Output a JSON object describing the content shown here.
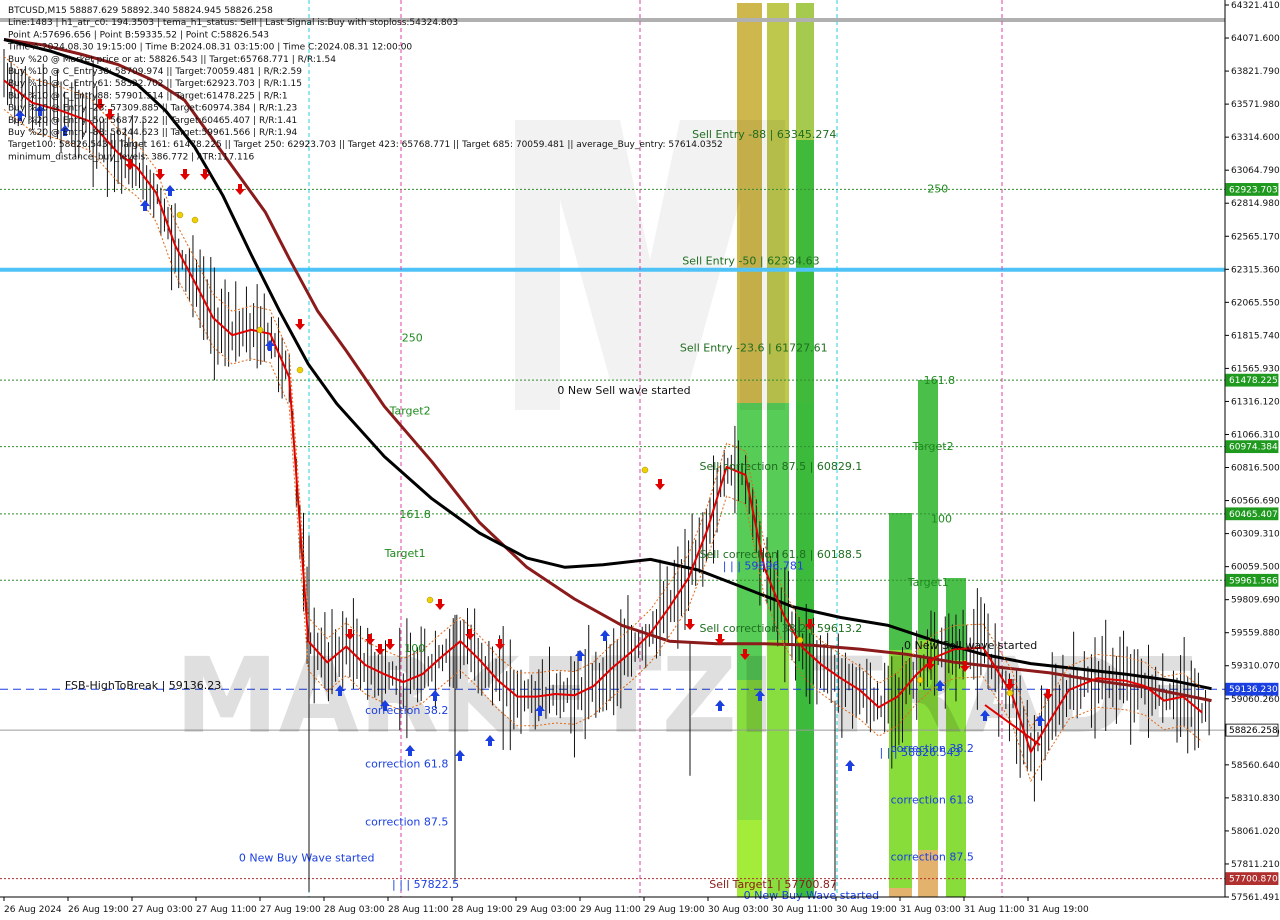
{
  "info": {
    "lines": [
      "BTCUSD,M15  58887.629 58892.340 58824.945 58826.258",
      "Line:1483 | h1_atr_c0: 194.3503 | tema_h1_status: Sell | Last Signal is:Buy with stoploss:54324.803",
      "Point A:57696.656 | Point B:59335.52 | Point C:58826.543",
      "Time A:2024.08.30 19:15:00 | Time B:2024.08.31 03:15:00 | Time C:2024.08.31 12:00:00",
      "Buy %20 @ Market price or at: 58826.543 || Target:65768.771 | R/R:1.54",
      "Buy %10 @ C_Entry38: 58709.974 || Target:70059.481 | R/R:2.59",
      "Buy %10 @ C_Entry61: 58322.702 || Target:62923.703 | R/R:1.15",
      "Buy %10 @ C_Entry88: 57901.514 || Target:61478.225 | R/R:1",
      "Buy %10 @ Entry -23: 57309.885 || Target:60974.384 | R/R:1.23",
      "Buy %20 @ Entry -50: 56877.522 || Target:60465.407 | R/R:1.41",
      "Buy %20 @ Entry -88: 56244.623 || Target:59961.566 | R/R:1.94",
      "Target100: 58826.543 || Target 161: 61478.225 || Target 250: 62923.703 || Target 423: 65768.771 || Target 685: 70059.481 || average_Buy_entry: 57614.0352",
      "minimum_distance_buy_levels: 386.772 | ATR:117.116"
    ]
  },
  "watermark": "MARKETZI TRADE",
  "colors": {
    "background": "#ffffff",
    "red_ma": "#8b1a1a",
    "black_ma": "#000000",
    "fast_ma": "#e00000",
    "buy_arrow": "#1a3fe0",
    "sell_arrow": "#e00000",
    "green_level": "#1f8a1f",
    "blue_line": "#4fc3f7",
    "dashed_blue": "#1a3fe0",
    "price_badge_green": "#1f9a1f",
    "price_badge_blue": "#1a3fe0",
    "price_badge_dark": "#ffffff",
    "price_badge_red": "#b03030"
  },
  "chart_data": {
    "type": "line",
    "title": "BTCUSD,M15",
    "ylim": [
      57561.491,
      64321.41
    ],
    "x_ticks": [
      "26 Aug 2024",
      "26 Aug 19:00",
      "27 Aug 03:00",
      "27 Aug 11:00",
      "27 Aug 19:00",
      "28 Aug 03:00",
      "28 Aug 11:00",
      "28 Aug 19:00",
      "29 Aug 03:00",
      "29 Aug 11:00",
      "29 Aug 19:00",
      "30 Aug 03:00",
      "30 Aug 11:00",
      "30 Aug 19:00",
      "31 Aug 03:00",
      "31 Aug 11:00",
      "31 Aug 19:00"
    ],
    "y_ticks": [
      "64321.410",
      "64071.600",
      "63821.790",
      "63571.980",
      "63314.600",
      "63064.790",
      "62814.980",
      "62565.170",
      "62315.360",
      "62065.550",
      "61815.740",
      "61565.930",
      "61316.120",
      "61066.310",
      "60816.500",
      "60566.690",
      "60309.310",
      "60059.500",
      "59809.690",
      "59559.880",
      "59310.070",
      "59060.260",
      "58802.880",
      "58560.640",
      "58310.830",
      "58061.020",
      "57811.210",
      "57561.491"
    ],
    "price_badges": [
      {
        "label": "62923.703",
        "value": 62923.703,
        "style": "green"
      },
      {
        "label": "62315.360",
        "value": 62315.36,
        "style": "cyan_line"
      },
      {
        "label": "61478.225",
        "value": 61478.225,
        "style": "green"
      },
      {
        "label": "60974.384",
        "value": 60974.384,
        "style": "green"
      },
      {
        "label": "60465.407",
        "value": 60465.407,
        "style": "green"
      },
      {
        "label": "59961.566",
        "value": 59961.566,
        "style": "green"
      },
      {
        "label": "59136.230",
        "value": 59136.23,
        "style": "blue"
      },
      {
        "label": "58826.258",
        "value": 58826.258,
        "style": "dark"
      },
      {
        "label": "57700.870",
        "value": 57700.87,
        "style": "red"
      }
    ],
    "levels": [
      {
        "name": "target-62923",
        "value": 62923.703,
        "type": "green-dotted"
      },
      {
        "name": "sell-entry-50",
        "value": 62315.36,
        "type": "cyan-solid"
      },
      {
        "name": "target-61478",
        "value": 61478.225,
        "type": "green-dotted"
      },
      {
        "name": "target-60974",
        "value": 60974.384,
        "type": "green-dotted"
      },
      {
        "name": "target-60465",
        "value": 60465.407,
        "type": "green-dotted"
      },
      {
        "name": "target-59961",
        "value": 59961.566,
        "type": "green-dotted"
      },
      {
        "name": "fsb-high",
        "value": 59136.23,
        "type": "blue-dashed"
      },
      {
        "name": "current",
        "value": 58826.258,
        "type": "gray-solid"
      },
      {
        "name": "sell-target",
        "value": 57700.87,
        "type": "red-dotted"
      }
    ],
    "series": [
      {
        "key": "ma_long_red",
        "points": [
          [
            0,
            64060
          ],
          [
            8,
            64020
          ],
          [
            16,
            63950
          ],
          [
            24,
            63870
          ],
          [
            32,
            63740
          ],
          [
            38,
            63600
          ],
          [
            42,
            63400
          ],
          [
            48,
            63100
          ],
          [
            55,
            62750
          ],
          [
            60,
            62400
          ],
          [
            66,
            62000
          ],
          [
            72,
            61700
          ],
          [
            80,
            61280
          ],
          [
            90,
            60860
          ],
          [
            100,
            60400
          ],
          [
            110,
            60060
          ],
          [
            120,
            59820
          ],
          [
            130,
            59620
          ],
          [
            140,
            59500
          ],
          [
            150,
            59480
          ],
          [
            160,
            59480
          ],
          [
            170,
            59470
          ],
          [
            180,
            59440
          ],
          [
            190,
            59400
          ],
          [
            200,
            59340
          ],
          [
            210,
            59300
          ],
          [
            220,
            59260
          ],
          [
            230,
            59200
          ],
          [
            240,
            59150
          ],
          [
            254,
            59050
          ]
        ],
        "color_key": "red_ma"
      },
      {
        "key": "ma_long_black",
        "points": [
          [
            0,
            64060
          ],
          [
            10,
            63970
          ],
          [
            20,
            63850
          ],
          [
            28,
            63720
          ],
          [
            34,
            63520
          ],
          [
            40,
            63250
          ],
          [
            46,
            62880
          ],
          [
            52,
            62430
          ],
          [
            58,
            62000
          ],
          [
            64,
            61600
          ],
          [
            70,
            61300
          ],
          [
            80,
            60900
          ],
          [
            90,
            60580
          ],
          [
            100,
            60320
          ],
          [
            110,
            60130
          ],
          [
            118,
            60060
          ],
          [
            126,
            60080
          ],
          [
            136,
            60120
          ],
          [
            146,
            60040
          ],
          [
            156,
            59900
          ],
          [
            166,
            59760
          ],
          [
            176,
            59680
          ],
          [
            186,
            59620
          ],
          [
            196,
            59500
          ],
          [
            206,
            59400
          ],
          [
            216,
            59330
          ],
          [
            226,
            59290
          ],
          [
            236,
            59250
          ],
          [
            246,
            59200
          ],
          [
            254,
            59140
          ]
        ],
        "color_key": "black_ma"
      },
      {
        "key": "ema_fast_red",
        "points": [
          [
            0,
            63750
          ],
          [
            6,
            63580
          ],
          [
            12,
            63520
          ],
          [
            18,
            63440
          ],
          [
            24,
            63200
          ],
          [
            28,
            63090
          ],
          [
            32,
            62900
          ],
          [
            36,
            62500
          ],
          [
            40,
            62230
          ],
          [
            44,
            61950
          ],
          [
            48,
            61820
          ],
          [
            52,
            61860
          ],
          [
            56,
            61830
          ],
          [
            60,
            61500
          ],
          [
            64,
            59500
          ],
          [
            68,
            59340
          ],
          [
            72,
            59460
          ],
          [
            76,
            59320
          ],
          [
            80,
            59250
          ],
          [
            84,
            59190
          ],
          [
            88,
            59250
          ],
          [
            92,
            59380
          ],
          [
            96,
            59500
          ],
          [
            100,
            59360
          ],
          [
            104,
            59200
          ],
          [
            108,
            59080
          ],
          [
            112,
            59080
          ],
          [
            116,
            59100
          ],
          [
            120,
            59090
          ],
          [
            124,
            59160
          ],
          [
            128,
            59300
          ],
          [
            132,
            59420
          ],
          [
            136,
            59560
          ],
          [
            140,
            59760
          ],
          [
            144,
            59980
          ],
          [
            148,
            60350
          ],
          [
            152,
            60820
          ],
          [
            156,
            60760
          ],
          [
            160,
            60050
          ],
          [
            164,
            59700
          ],
          [
            168,
            59450
          ],
          [
            172,
            59320
          ],
          [
            176,
            59220
          ],
          [
            180,
            59130
          ],
          [
            184,
            59000
          ],
          [
            188,
            59080
          ],
          [
            192,
            59250
          ],
          [
            196,
            59380
          ],
          [
            200,
            59440
          ],
          [
            206,
            59450
          ],
          [
            212,
            59100
          ],
          [
            216,
            58660
          ],
          [
            220,
            58900
          ],
          [
            224,
            59130
          ],
          [
            230,
            59220
          ],
          [
            236,
            59200
          ],
          [
            240,
            59160
          ],
          [
            244,
            59050
          ],
          [
            248,
            59080
          ],
          [
            252,
            58960
          ]
        ],
        "color_key": "fast_ma"
      }
    ],
    "annotations": [
      {
        "text": "Sell Entry -88 | 63345.274",
        "value": 63345.274,
        "col": 0.565,
        "color": "#1f6e1f"
      },
      {
        "text": "250",
        "value": 62930,
        "col": 0.757,
        "color": "#1f8a1f"
      },
      {
        "text": "Sell Entry -50 | 62384.63",
        "value": 62384.63,
        "col": 0.557,
        "color": "#1f6e1f"
      },
      {
        "text": "250",
        "value": 61800,
        "col": 0.328,
        "color": "#1f8a1f"
      },
      {
        "text": "Sell Entry -23.6 | 61727.61",
        "value": 61727.61,
        "col": 0.555,
        "color": "#1f6e1f"
      },
      {
        "text": "161.8",
        "value": 61480,
        "col": 0.754,
        "color": "#1f8a1f"
      },
      {
        "text": "0 New Sell wave started",
        "value": 61405,
        "col": 0.455,
        "color": "#111"
      },
      {
        "text": "Target2",
        "value": 61250,
        "col": 0.318,
        "color": "#1f8a1f"
      },
      {
        "text": "Target2",
        "value": 60980,
        "col": 0.745,
        "color": "#1f8a1f"
      },
      {
        "text": "Sell correction 87.5 | 60829.1",
        "value": 60829.1,
        "col": 0.571,
        "color": "#1f6e1f"
      },
      {
        "text": "161.8",
        "value": 60465,
        "col": 0.326,
        "color": "#1f8a1f"
      },
      {
        "text": "100",
        "value": 60430,
        "col": 0.76,
        "color": "#1f8a1f"
      },
      {
        "text": "Target1",
        "value": 60170,
        "col": 0.314,
        "color": "#1f8a1f"
      },
      {
        "text": "Sell correction 61.8 | 60188.5",
        "value": 60160,
        "col": 0.571,
        "color": "#1f6e1f"
      },
      {
        "text": "| | | 59896.781",
        "value": 60075,
        "col": 0.59,
        "color": "#1f3fe0"
      },
      {
        "text": "Target1",
        "value": 59950,
        "col": 0.741,
        "color": "#1f8a1f"
      },
      {
        "text": "Sell correction 38.2 | 59613.2",
        "value": 59600,
        "col": 0.571,
        "color": "#1f6e1f"
      },
      {
        "text": "0 New Sell wave started",
        "value": 59470,
        "col": 0.738,
        "color": "#111"
      },
      {
        "text": "100",
        "value": 59450,
        "col": 0.33,
        "color": "#1f8a1f"
      },
      {
        "text": "FSB-HighToBreak | 59136.23",
        "value": 59170,
        "col": 0.053,
        "color": "#111"
      },
      {
        "text": "correction 38.2",
        "value": 58980,
        "col": 0.298,
        "color": "#1a3fe0"
      },
      {
        "text": "correction 38.2",
        "value": 58690,
        "col": 0.727,
        "color": "#1a3fe0"
      },
      {
        "text": "| | | 58826.543",
        "value": 58660,
        "col": 0.718,
        "color": "#1a3fe0"
      },
      {
        "text": "correction 61.8",
        "value": 58575,
        "col": 0.298,
        "color": "#1a3fe0"
      },
      {
        "text": "correction 61.8",
        "value": 58300,
        "col": 0.727,
        "color": "#1a3fe0"
      },
      {
        "text": "correction 87.5",
        "value": 58135,
        "col": 0.298,
        "color": "#1a3fe0"
      },
      {
        "text": "correction 87.5",
        "value": 57870,
        "col": 0.727,
        "color": "#1a3fe0"
      },
      {
        "text": "0 New Buy Wave started",
        "value": 57860,
        "col": 0.195,
        "color": "#1a3fe0"
      },
      {
        "text": "| | | 57822.5",
        "value": 57660,
        "col": 0.32,
        "color": "#1a3fe0"
      },
      {
        "text": "Sell Target1 | 57700.87",
        "value": 57660,
        "col": 0.579,
        "color": "#8b1a1a"
      },
      {
        "text": "0 New Buy Wave started",
        "value": 57575,
        "col": 0.607,
        "color": "#1a3fe0"
      }
    ]
  }
}
